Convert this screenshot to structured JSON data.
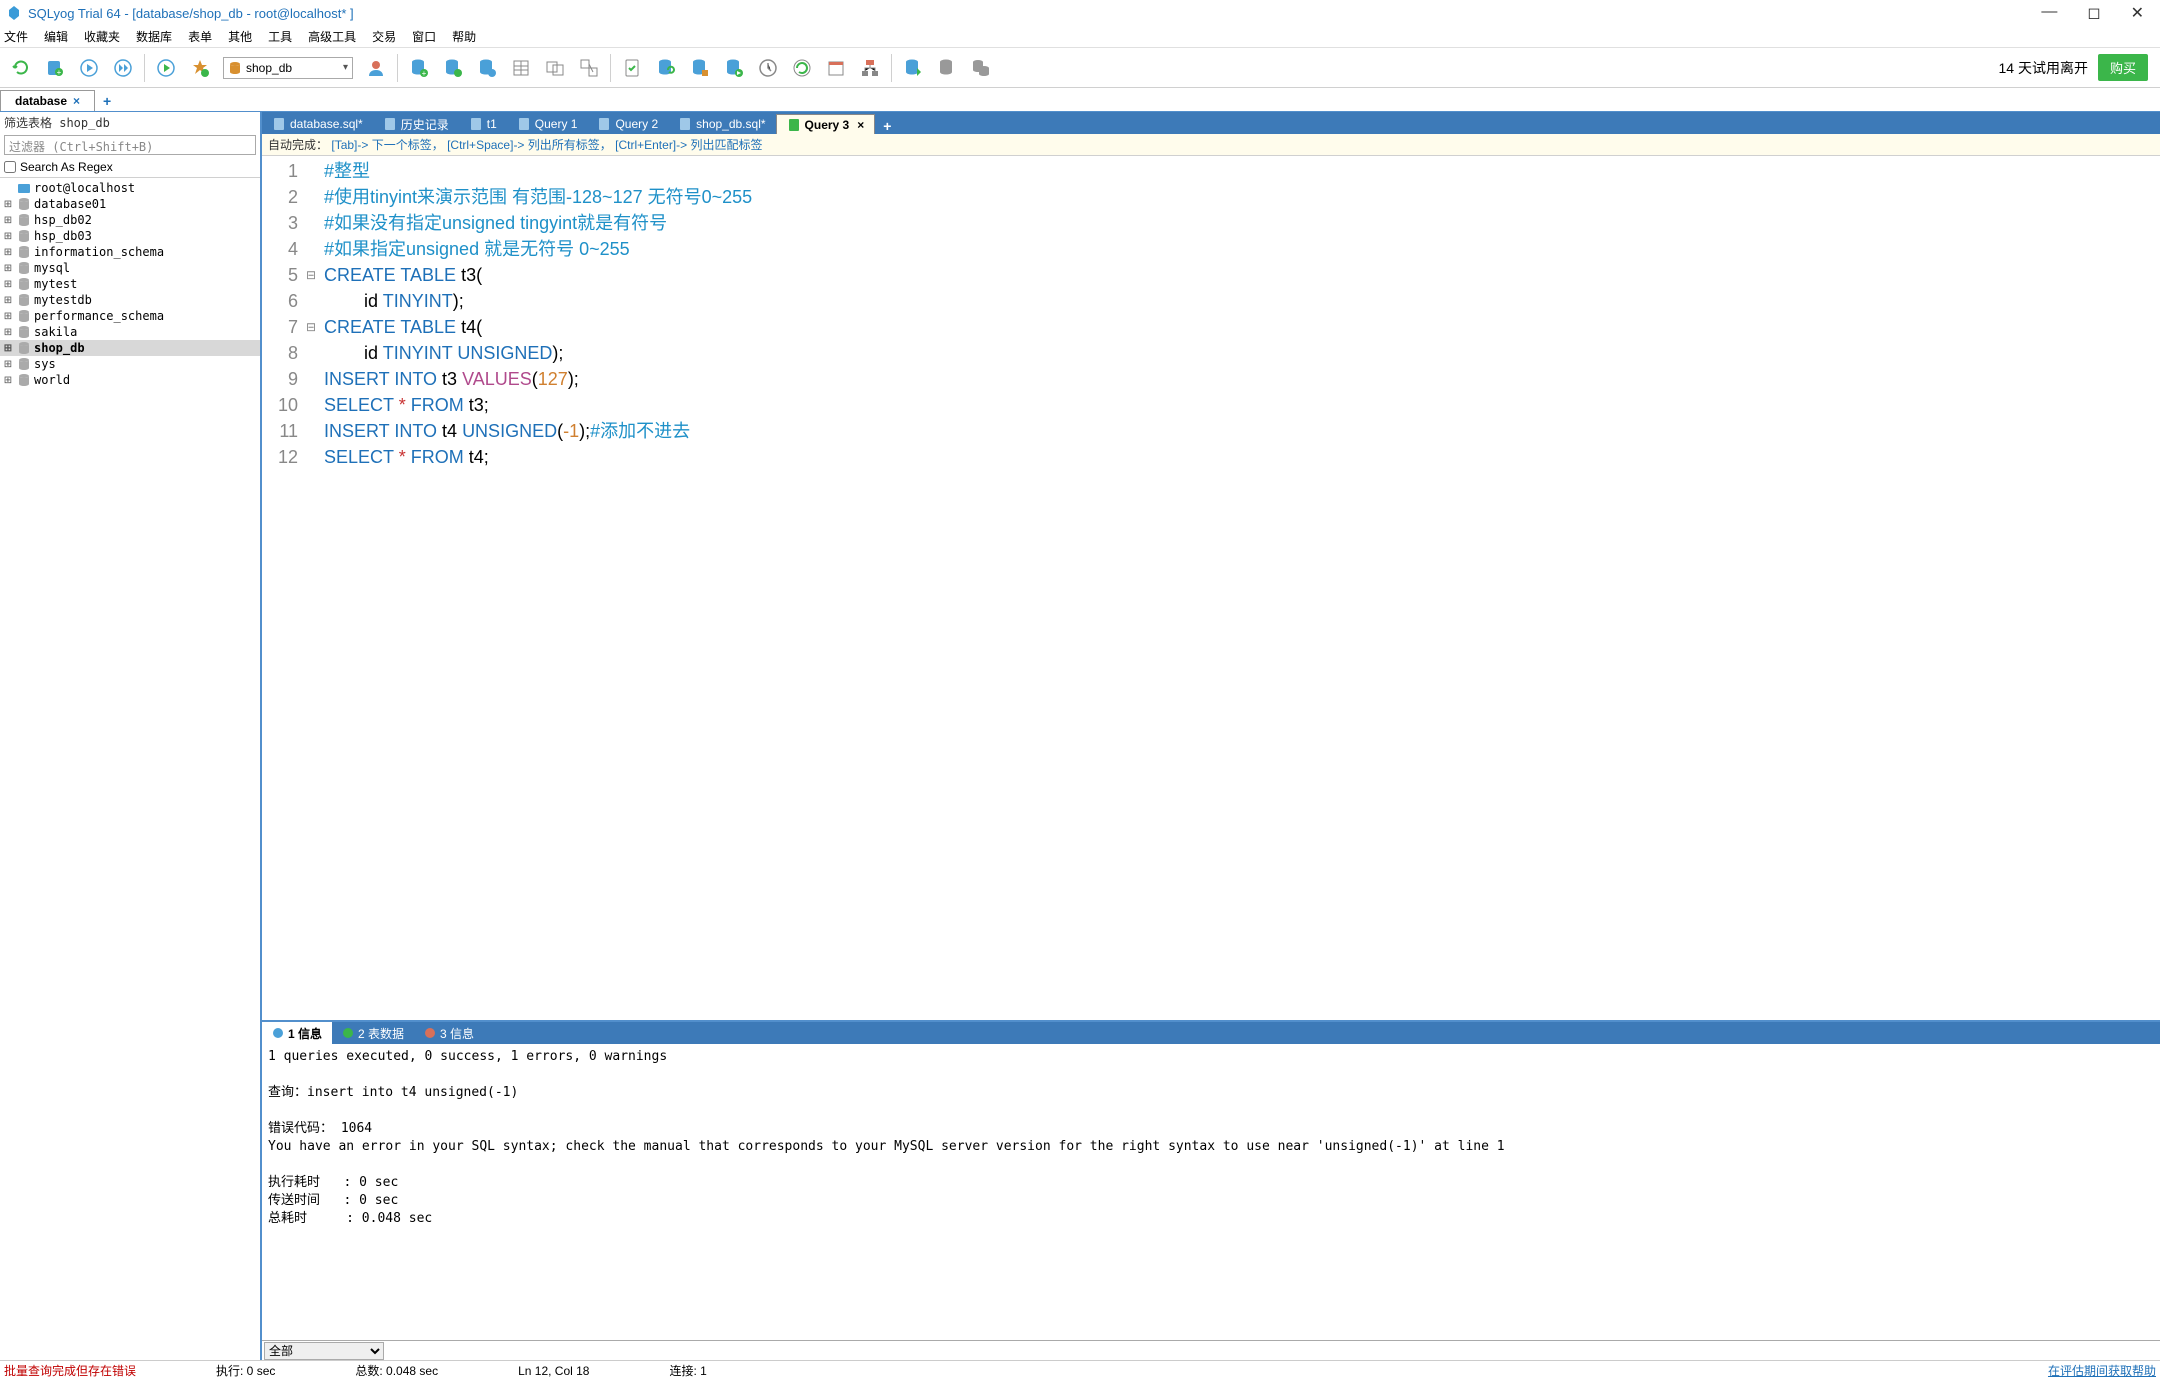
{
  "title": "SQLyog Trial 64 - [database/shop_db - root@localhost* ]",
  "menu": [
    "文件",
    "编辑",
    "收藏夹",
    "数据库",
    "表单",
    "其他",
    "工具",
    "高级工具",
    "交易",
    "窗口",
    "帮助"
  ],
  "db_selector": "shop_db",
  "trial_text": "14 天试用离开",
  "buy_text": "购买",
  "conn_tab": "database",
  "sidebar": {
    "header": "筛选表格 shop_db",
    "filter_placeholder": "过滤器 (Ctrl+Shift+B)",
    "regex_label": "Search As Regex",
    "root": "root@localhost",
    "dbs": [
      "database01",
      "hsp_db02",
      "hsp_db03",
      "information_schema",
      "mysql",
      "mytest",
      "mytestdb",
      "performance_schema",
      "sakila",
      "shop_db",
      "sys",
      "world"
    ],
    "selected": "shop_db"
  },
  "editor_tabs": [
    {
      "label": "database.sql*",
      "active": false
    },
    {
      "label": "历史记录",
      "active": false
    },
    {
      "label": "t1",
      "active": false
    },
    {
      "label": "Query 1",
      "active": false
    },
    {
      "label": "Query 2",
      "active": false
    },
    {
      "label": "shop_db.sql*",
      "active": false
    },
    {
      "label": "Query 3",
      "active": true,
      "closable": true
    }
  ],
  "hint": {
    "prefix": "自动完成：",
    "k1": "[Tab]",
    "t1": "-> 下一个标签，",
    "k2": "[Ctrl+Space]",
    "t2": "-> 列出所有标签，",
    "k3": "[Ctrl+Enter]",
    "t3": "-> 列出匹配标签"
  },
  "code_lines": [
    {
      "n": 1,
      "html": "<span class='c-comment'>#整型</span>"
    },
    {
      "n": 2,
      "html": "<span class='c-comment'>#使用tinyint来演示范围 有范围-128~127 无符号0~255</span>"
    },
    {
      "n": 3,
      "html": "<span class='c-comment'>#如果没有指定unsigned tingyint就是有符号</span>"
    },
    {
      "n": 4,
      "html": "<span class='c-comment'>#如果指定unsigned 就是无符号 0~255</span>"
    },
    {
      "n": 5,
      "fold": "⊟",
      "html": "<span class='c-kw'>CREATE</span> <span class='c-kw'>TABLE</span> t3("
    },
    {
      "n": 6,
      "html": "        id <span class='c-kw'>TINYINT</span>);"
    },
    {
      "n": 7,
      "fold": "⊟",
      "html": "<span class='c-kw'>CREATE</span> <span class='c-kw'>TABLE</span> t4("
    },
    {
      "n": 8,
      "html": "        id <span class='c-kw'>TINYINT</span> <span class='c-kw'>UNSIGNED</span>);"
    },
    {
      "n": 9,
      "html": "<span class='c-kw'>INSERT</span> <span class='c-kw'>INTO</span> t3 <span class='c-func'>VALUES</span>(<span class='c-num'>127</span>);"
    },
    {
      "n": 10,
      "html": "<span class='c-kw'>SELECT</span> <span class='c-star'>*</span> <span class='c-kw'>FROM</span> t3;"
    },
    {
      "n": 11,
      "html": "<span class='c-kw'>INSERT</span> <span class='c-kw'>INTO</span> t4 <span class='c-kw'>UNSIGNED</span>(<span class='c-num'>-1</span>);<span class='c-comment'>#添加不进去</span>"
    },
    {
      "n": 12,
      "html": "<span class='c-kw'>SELECT</span> <span class='c-star'>*</span> <span class='c-kw'>FROM</span> t4;"
    }
  ],
  "result_tabs": [
    {
      "label": "1 信息",
      "active": true
    },
    {
      "label": "2 表数据",
      "active": false
    },
    {
      "label": "3 信息",
      "active": false
    }
  ],
  "result_text": "1 queries executed, 0 success, 1 errors, 0 warnings\n\n查询：insert into t4 unsigned(-1)\n\n错误代码： 1064\nYou have an error in your SQL syntax; check the manual that corresponds to your MySQL server version for the right syntax to use near 'unsigned(-1)' at line 1\n\n执行耗时   : 0 sec\n传送时间   : 0 sec\n总耗时     : 0.048 sec",
  "result_footer_sel": "全部",
  "status": {
    "err": "批量查询完成但存在错误",
    "exec": "执行:  0 sec",
    "total": "总数:  0.048 sec",
    "pos": "Ln 12, Col 18",
    "conn": "连接:  1",
    "help": "在评估期间获取帮助"
  }
}
